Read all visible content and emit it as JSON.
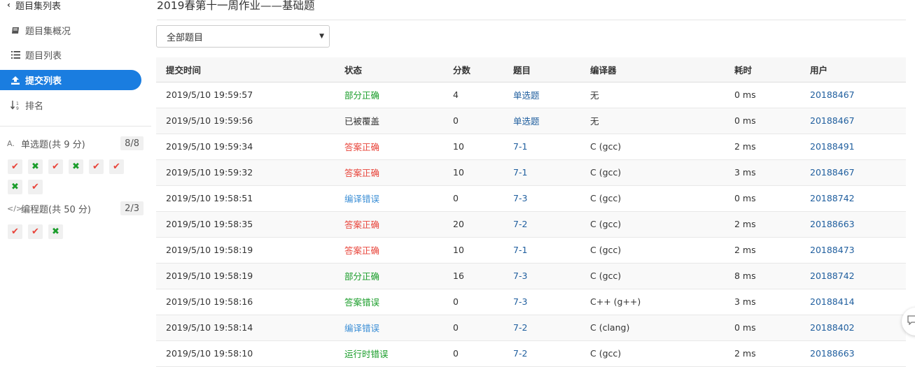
{
  "sidebar": {
    "back_label": "题目集列表",
    "nav": [
      {
        "label": "题目集概况",
        "icon": "book-icon"
      },
      {
        "label": "题目列表",
        "icon": "list-icon"
      },
      {
        "label": "提交列表",
        "icon": "upload-icon",
        "active": true
      },
      {
        "label": "排名",
        "icon": "sort-numeric-icon"
      }
    ],
    "sections": [
      {
        "title": "单选题(共 9 分)",
        "score": "8/8",
        "icon": "font-icon",
        "results": [
          "correct",
          "wrong",
          "correct",
          "wrong",
          "correct",
          "correct",
          "wrong",
          "correct"
        ]
      },
      {
        "title": "编程题(共 50 分)",
        "score": "2/3",
        "icon": "code-icon",
        "results": [
          "correct",
          "correct",
          "wrong"
        ]
      }
    ]
  },
  "page": {
    "title": "2019春第十一周作业——基础题",
    "filter_value": "全部题目"
  },
  "table": {
    "headers": [
      "提交时间",
      "状态",
      "分数",
      "题目",
      "编译器",
      "耗时",
      "用户"
    ],
    "rows": [
      {
        "time": "2019/5/10 19:59:57",
        "status": "部分正确",
        "status_type": "partial",
        "score": "4",
        "problem": "单选题",
        "compiler": "无",
        "elapsed": "0 ms",
        "user": "20188467"
      },
      {
        "time": "2019/5/10 19:59:56",
        "status": "已被覆盖",
        "status_type": "over",
        "score": "0",
        "problem": "单选题",
        "compiler": "无",
        "elapsed": "0 ms",
        "user": "20188467"
      },
      {
        "time": "2019/5/10 19:59:34",
        "status": "答案正确",
        "status_type": "correct",
        "score": "10",
        "problem": "7-1",
        "compiler": "C (gcc)",
        "elapsed": "2 ms",
        "user": "20188491"
      },
      {
        "time": "2019/5/10 19:59:32",
        "status": "答案正确",
        "status_type": "correct",
        "score": "10",
        "problem": "7-1",
        "compiler": "C (gcc)",
        "elapsed": "3 ms",
        "user": "20188467"
      },
      {
        "time": "2019/5/10 19:58:51",
        "status": "编译错误",
        "status_type": "ce",
        "score": "0",
        "problem": "7-3",
        "compiler": "C (gcc)",
        "elapsed": "0 ms",
        "user": "20188742"
      },
      {
        "time": "2019/5/10 19:58:35",
        "status": "答案正确",
        "status_type": "correct",
        "score": "20",
        "problem": "7-2",
        "compiler": "C (gcc)",
        "elapsed": "2 ms",
        "user": "20188663"
      },
      {
        "time": "2019/5/10 19:58:19",
        "status": "答案正确",
        "status_type": "correct",
        "score": "10",
        "problem": "7-1",
        "compiler": "C (gcc)",
        "elapsed": "2 ms",
        "user": "20188473"
      },
      {
        "time": "2019/5/10 19:58:19",
        "status": "部分正确",
        "status_type": "partial",
        "score": "16",
        "problem": "7-3",
        "compiler": "C (gcc)",
        "elapsed": "8 ms",
        "user": "20188742"
      },
      {
        "time": "2019/5/10 19:58:16",
        "status": "答案错误",
        "status_type": "wrong",
        "score": "0",
        "problem": "7-3",
        "compiler": "C++ (g++)",
        "elapsed": "3 ms",
        "user": "20188414"
      },
      {
        "time": "2019/5/10 19:58:14",
        "status": "编译错误",
        "status_type": "ce",
        "score": "0",
        "problem": "7-2",
        "compiler": "C (clang)",
        "elapsed": "0 ms",
        "user": "20188402"
      },
      {
        "time": "2019/5/10 19:58:10",
        "status": "运行时错误",
        "status_type": "rte",
        "score": "0",
        "problem": "7-2",
        "compiler": "C (gcc)",
        "elapsed": "2 ms",
        "user": "20188663"
      }
    ]
  },
  "colors": {
    "accent": "#1a7de0",
    "correct": "#e8443a",
    "partial": "#1a9d2a",
    "compile_error": "#3c8fd6",
    "link": "#1f5e9e"
  }
}
